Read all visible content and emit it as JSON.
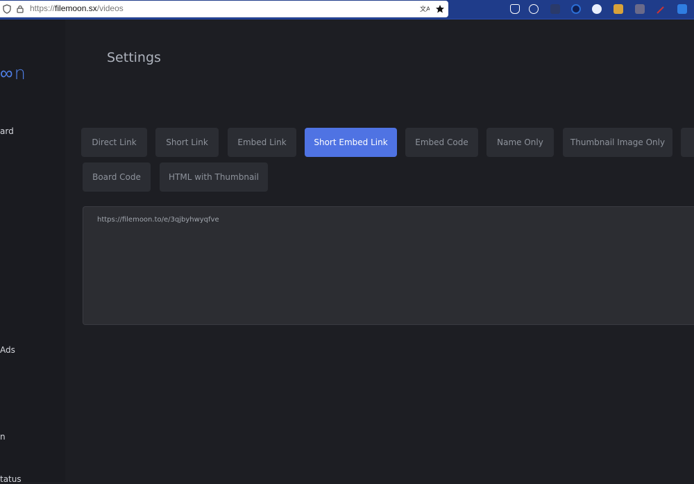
{
  "browser": {
    "url_prefix": "https://",
    "url_domain": "filemoon.sx",
    "url_path": "/videos"
  },
  "sidebar": {
    "logo": "∞n",
    "items": [
      "ard",
      "Ads",
      "n",
      "tatus"
    ]
  },
  "page": {
    "title": "Settings"
  },
  "link_tabs": {
    "items": [
      "Direct Link",
      "Short Link",
      "Embed Link",
      "Short Embed Link",
      "Embed Code",
      "Name Only",
      "Thumbnail Image Only",
      "Board Code",
      "HTML with Thumbnail"
    ],
    "active": "Short Embed Link"
  },
  "output": {
    "value": "https://filemoon.to/e/3qjbyhwyqfve"
  },
  "colors": {
    "accent": "#4f73e3",
    "background": "#1d1e23",
    "tab_bg": "#2b2d33"
  }
}
